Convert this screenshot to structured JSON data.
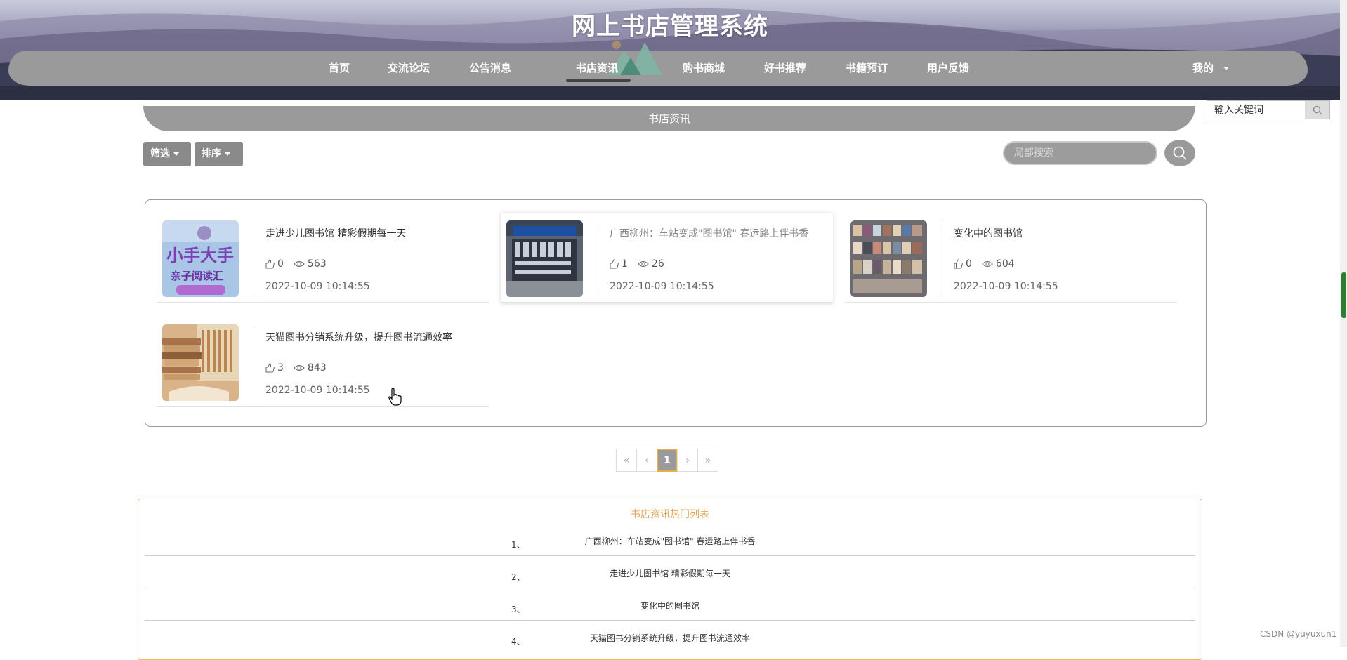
{
  "header": {
    "site_title": "网上书店管理系统",
    "nav": [
      {
        "label": "首页"
      },
      {
        "label": "交流论坛"
      },
      {
        "label": "公告消息"
      },
      {
        "label": "书店资讯",
        "active": true
      },
      {
        "label": "购书商城"
      },
      {
        "label": "好书推荐"
      },
      {
        "label": "书籍预订"
      },
      {
        "label": "用户反馈"
      }
    ],
    "user_menu": "我的",
    "search_placeholder": "输入关键词"
  },
  "section": {
    "title": "书店资讯",
    "filter_label": "筛选",
    "sort_label": "排序",
    "local_search_placeholder": "局部搜索"
  },
  "news": [
    {
      "title": "走进少儿图书馆 精彩假期每一天",
      "likes": "0",
      "views": "563",
      "date": "2022-10-09 10:14:55",
      "thumb_icon": "kids-reading-image"
    },
    {
      "title": "广西柳州：车站变成\"图书馆\" 春运路上伴书香",
      "likes": "1",
      "views": "26",
      "date": "2022-10-09 10:14:55",
      "thumb_icon": "station-bookshelf-image"
    },
    {
      "title": "变化中的图书馆",
      "likes": "0",
      "views": "604",
      "date": "2022-10-09 10:14:55",
      "thumb_icon": "library-shelves-image"
    },
    {
      "title": "天猫图书分销系统升级，提升图书流通效率",
      "likes": "3",
      "views": "843",
      "date": "2022-10-09 10:14:55",
      "thumb_icon": "book-stack-image"
    }
  ],
  "pagination": {
    "first": "«",
    "prev": "‹",
    "current": "1",
    "next": "›",
    "last": "»"
  },
  "hot_list": {
    "title": "书店资讯热门列表",
    "items": [
      {
        "num": "1、",
        "title": "广西柳州：车站变成\"图书馆\" 春运路上伴书香"
      },
      {
        "num": "2、",
        "title": "走进少儿图书馆 精彩假期每一天"
      },
      {
        "num": "3、",
        "title": "变化中的图书馆"
      },
      {
        "num": "4、",
        "title": "天猫图书分销系统升级，提升图书流通效率"
      }
    ]
  },
  "watermark": "CSDN @yuyuxun1",
  "colors": {
    "nav_gray": "#9a9a9a",
    "accent_gold": "#e3a65a",
    "header_dark": "#3e3e58"
  }
}
